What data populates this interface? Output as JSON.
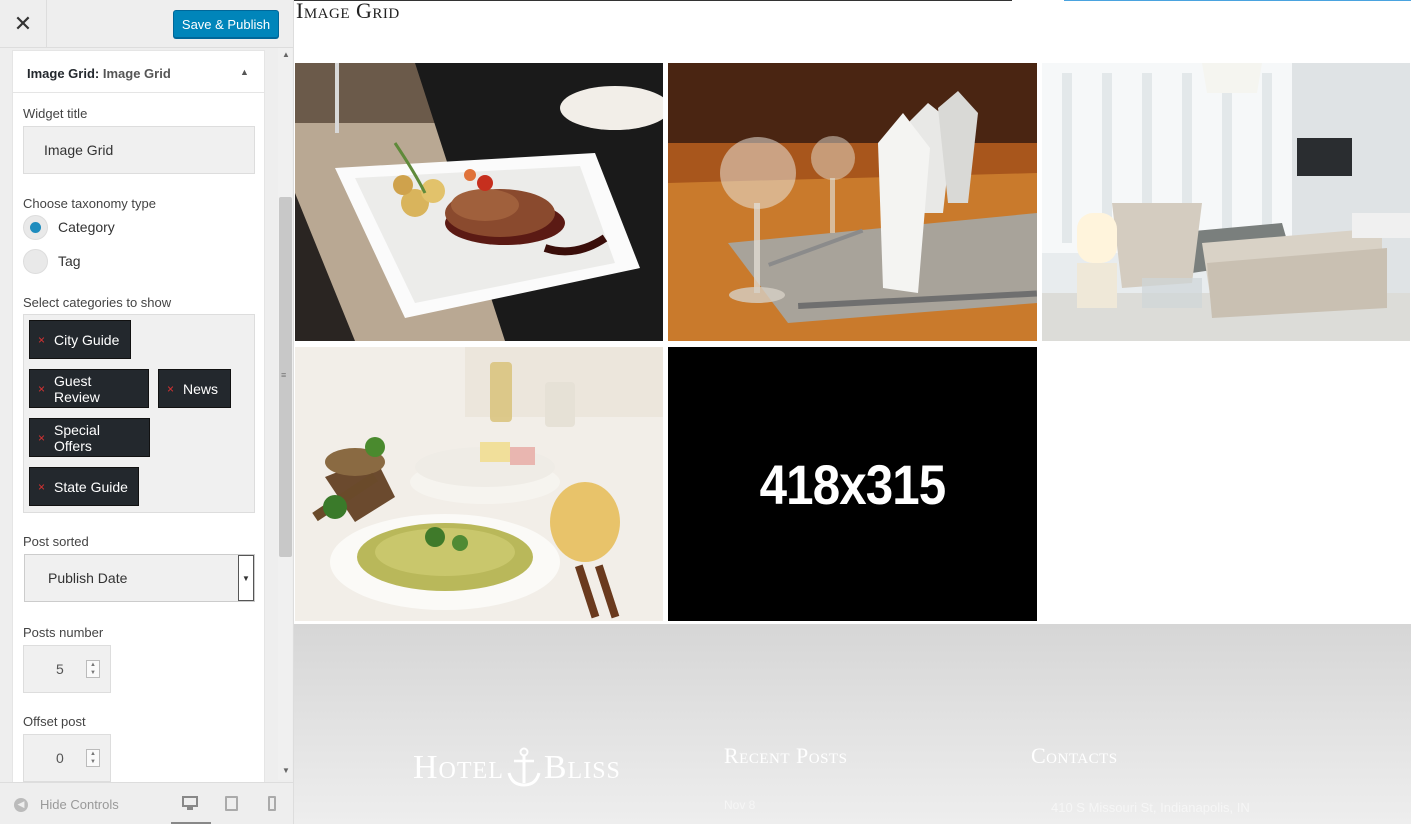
{
  "toolbar": {
    "close_glyph": "✕",
    "publish_label": "Save & Publish"
  },
  "widget": {
    "head_prefix": "Image Grid:",
    "head_name": "Image Grid",
    "collapse_glyph": "▲",
    "title_label": "Widget title",
    "title_value": "Image Grid",
    "taxonomy_label": "Choose taxonomy type",
    "taxonomy_options": [
      "Category",
      "Tag"
    ],
    "taxonomy_selected": "Category",
    "categories_label": "Select categories to show",
    "categories": [
      "City Guide",
      "Guest Review",
      "News",
      "Special Offers",
      "State Guide"
    ],
    "remove_glyph": "×",
    "sorted_label": "Post sorted",
    "sorted_value": "Publish Date",
    "posts_number_label": "Posts number",
    "posts_number_value": "5",
    "offset_label": "Offset post",
    "offset_value": "0"
  },
  "footer_controls": {
    "hide_label": "Hide Controls",
    "devices": [
      "desktop",
      "tablet",
      "mobile"
    ],
    "active_device": "desktop"
  },
  "preview": {
    "grid_title": "Image Grid",
    "tiles": [
      {
        "name": "steak-dish-photo"
      },
      {
        "name": "restaurant-table-photo"
      },
      {
        "name": "living-room-photo"
      },
      {
        "name": "pasta-dish-photo"
      },
      {
        "name": "placeholder-image",
        "text": "418x315"
      }
    ],
    "site_footer": {
      "logo_left": "Hotel",
      "logo_right": "Bliss",
      "recent_heading": "Recent Posts",
      "contacts_heading": "Contacts",
      "recent_date": "Nov 8",
      "contact_address": "410 S Missouri St, Indianapolis, IN"
    }
  },
  "colors": {
    "publish_blue": "#0085ba",
    "chip_dark": "#23282d",
    "remove_red": "#dc3232",
    "radio_blue": "#1e8cbe"
  }
}
